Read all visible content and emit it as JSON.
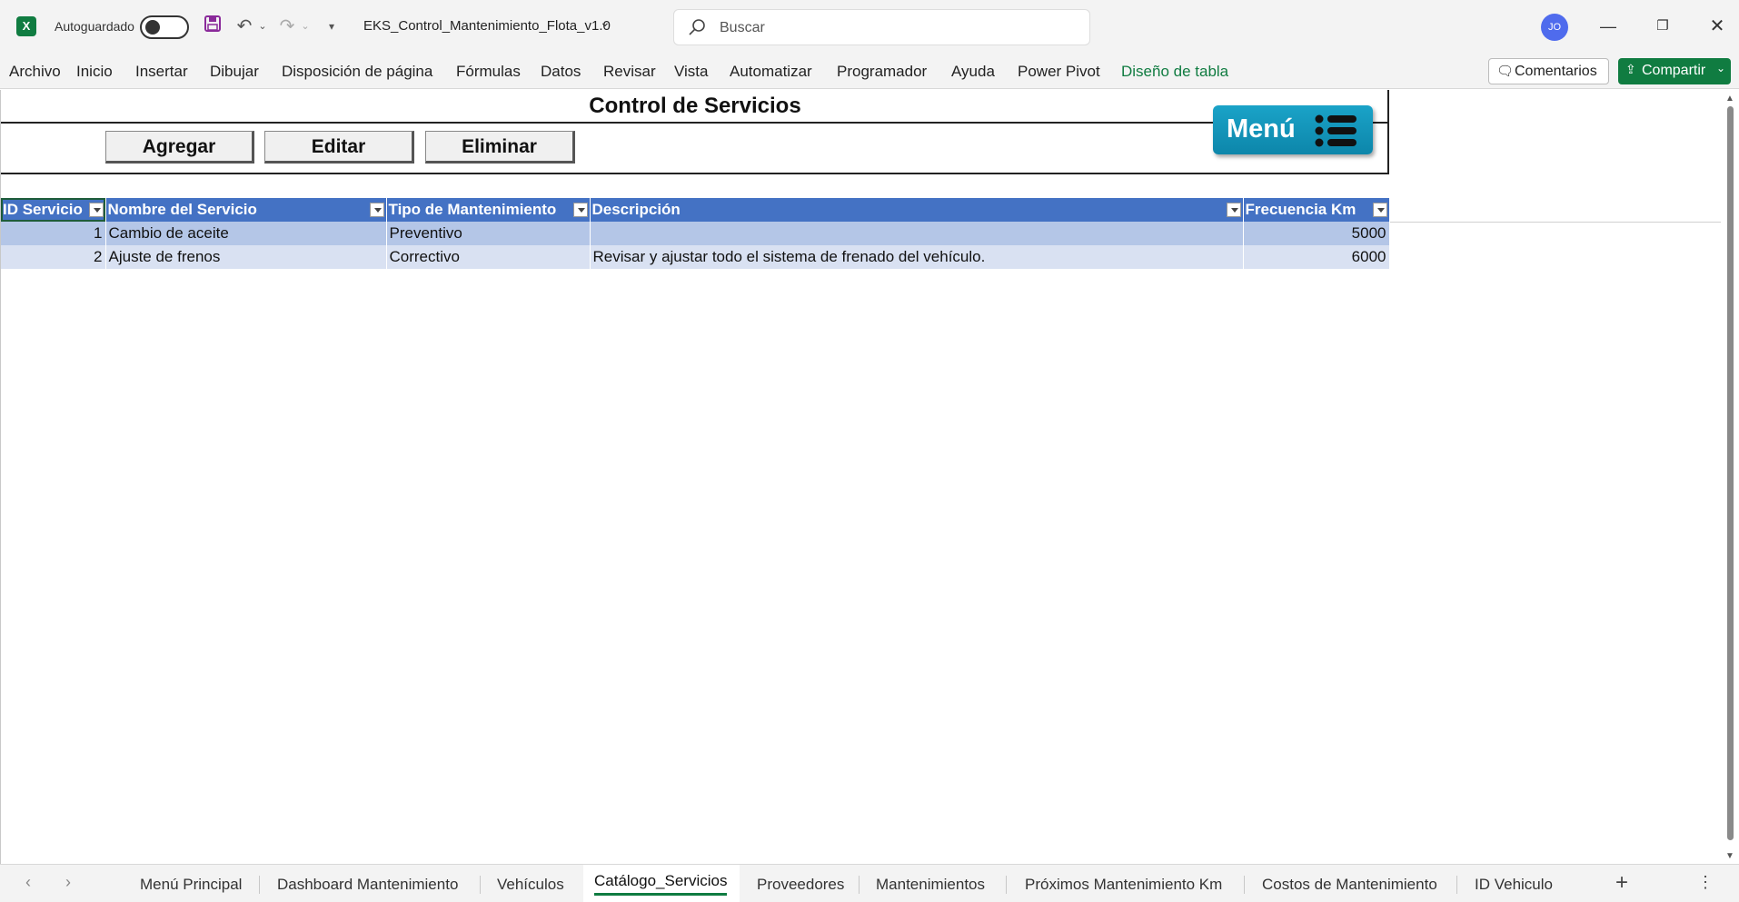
{
  "titlebar": {
    "autosave_label": "Autoguardado",
    "doc_title": "EKS_Control_Mantenimiento_Flota_v1.0",
    "search_placeholder": "Buscar",
    "avatar_initials": "JO",
    "app_logo": "X"
  },
  "ribbon": {
    "tabs": [
      "Archivo",
      "Inicio",
      "Insertar",
      "Dibujar",
      "Disposición de página",
      "Fórmulas",
      "Datos",
      "Revisar",
      "Vista",
      "Automatizar",
      "Programador",
      "Ayuda",
      "Power Pivot",
      "Diseño de tabla"
    ],
    "comments_label": "Comentarios",
    "share_label": "Compartir"
  },
  "panel": {
    "title": "Control de Servicios",
    "add_label": "Agregar",
    "edit_label": "Editar",
    "delete_label": "Eliminar",
    "menu_label": "Menú"
  },
  "table": {
    "headers": [
      "ID Servicio",
      "Nombre del Servicio",
      "Tipo de Mantenimiento",
      "Descripción",
      "Frecuencia Km"
    ],
    "rows": [
      [
        "1",
        "Cambio de aceite",
        "Preventivo",
        "",
        "5000"
      ],
      [
        "2",
        "Ajuste de frenos",
        "Correctivo",
        "Revisar y ajustar todo el sistema de frenado del vehículo.",
        "6000"
      ]
    ]
  },
  "sheet_tabs": [
    "Menú Principal",
    "Dashboard Mantenimiento",
    "Vehículos",
    "Catálogo_Servicios",
    "Proveedores",
    "Mantenimientos",
    "Próximos Mantenimiento Km",
    "Costos de Mantenimiento",
    "ID Vehiculo"
  ],
  "active_sheet": "Catálogo_Servicios",
  "colors": {
    "header_blue": "#4472c4",
    "row_band_1": "#b4c6e7",
    "row_band_2": "#d9e1f2",
    "excel_green": "#107c41",
    "menu_button": "#1aa3c8"
  }
}
